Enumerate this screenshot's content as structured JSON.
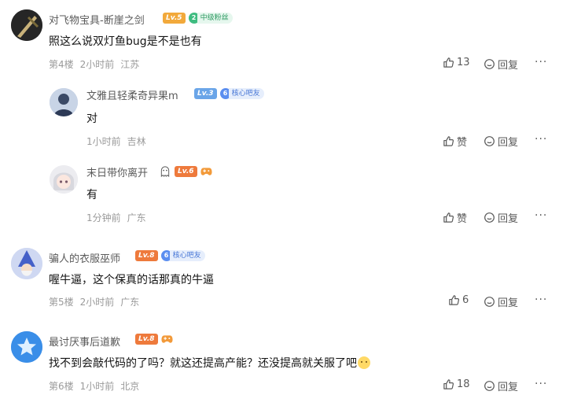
{
  "comments": [
    {
      "user": "对飞物宝具-断崖之剑",
      "level": "Lv.5",
      "badge": {
        "num": "2",
        "label": "中级粉丝"
      },
      "text": "照这么说双灯鱼bug是不是也有",
      "floor": "第4楼",
      "time": "2小时前",
      "location": "江苏",
      "likes": "13",
      "reply_label": "回复",
      "replies": [
        {
          "user": "文雅且轻柔奇异果m",
          "level": "Lv.3",
          "badge": {
            "num": "6",
            "label": "核心吧友"
          },
          "text": "对",
          "time": "1小时前",
          "location": "吉林",
          "likes": "赞",
          "reply_label": "回复"
        },
        {
          "user": "末日带你离开",
          "level": "Lv.6",
          "text": "有",
          "time": "1分钟前",
          "location": "广东",
          "likes": "赞",
          "reply_label": "回复"
        }
      ]
    },
    {
      "user": "骗人的衣服巫师",
      "level": "Lv.8",
      "badge": {
        "num": "6",
        "label": "核心吧友"
      },
      "text": "喔牛逼，这个保真的话那真的牛逼",
      "floor": "第5楼",
      "time": "2小时前",
      "location": "广东",
      "likes": "6",
      "reply_label": "回复"
    },
    {
      "user": "最讨厌事后道歉",
      "level": "Lv.8",
      "text": "找不到会敲代码的了吗？就这还提高产能？还没提高就关服了吧",
      "floor": "第6楼",
      "time": "1小时前",
      "location": "北京",
      "likes": "18",
      "reply_label": "回复"
    }
  ],
  "more_label": "···",
  "colors": {
    "text": "#141414",
    "meta": "#9a9a9a",
    "username": "#5a5a5a",
    "level_orange": "#ee7a3c",
    "level_blue": "#6aa5e8",
    "level_gold": "#f2a93b"
  }
}
